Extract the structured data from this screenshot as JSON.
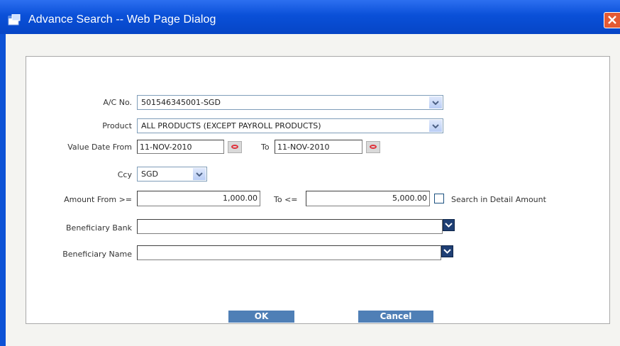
{
  "window": {
    "title": "Advance Search -- Web Page Dialog"
  },
  "form": {
    "account": {
      "label": "A/C No.",
      "value": "501546345001-SGD"
    },
    "product": {
      "label": "Product",
      "value": "ALL PRODUCTS (EXCEPT PAYROLL PRODUCTS)"
    },
    "value_date": {
      "label": "Value Date From",
      "from": "11-NOV-2010",
      "to_label": "To",
      "to": "11-NOV-2010"
    },
    "currency": {
      "label": "Ccy",
      "value": "SGD"
    },
    "amount": {
      "label": "Amount From >=",
      "from": "1,000.00",
      "to_label": "To <=",
      "to": "5,000.00",
      "detail_label": "Search in Detail Amount",
      "detail_checked": false
    },
    "beneficiary_bank": {
      "label": "Beneficiary Bank",
      "value": ""
    },
    "beneficiary_name": {
      "label": "Beneficiary Name",
      "value": ""
    }
  },
  "buttons": {
    "ok": "OK",
    "cancel": "Cancel"
  }
}
